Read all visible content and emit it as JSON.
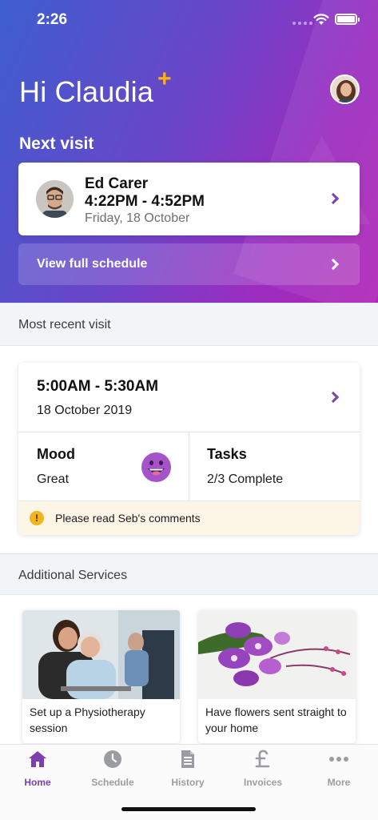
{
  "status_bar": {
    "time": "2:26"
  },
  "header": {
    "greeting": "Hi Claudia",
    "plus_mark": "+"
  },
  "next_visit": {
    "label": "Next visit",
    "carer_name": "Ed Carer",
    "time_range": "4:22PM - 4:52PM",
    "date": "Friday, 18 October"
  },
  "schedule_button": {
    "label": "View full schedule"
  },
  "recent": {
    "section_title": "Most recent visit",
    "time_range": "5:00AM - 5:30AM",
    "date": "18 October 2019",
    "mood_label": "Mood",
    "mood_value": "Great",
    "tasks_label": "Tasks",
    "tasks_value": "2/3 Complete",
    "notice": "Please read Seb's comments",
    "warning_glyph": "!"
  },
  "additional": {
    "section_title": "Additional Services",
    "cards": [
      {
        "text": "Set up a Physiotherapy session"
      },
      {
        "text": "Have flowers sent straight to your home"
      }
    ]
  },
  "tabs": [
    {
      "label": "Home",
      "icon": "home-icon",
      "active": true
    },
    {
      "label": "Schedule",
      "icon": "clock-icon",
      "active": false
    },
    {
      "label": "History",
      "icon": "document-icon",
      "active": false
    },
    {
      "label": "Invoices",
      "icon": "pound-icon",
      "active": false
    },
    {
      "label": "More",
      "icon": "more-dots-icon",
      "active": false
    }
  ],
  "colors": {
    "accent_purple": "#7b3fb1",
    "warning_yellow": "#f1b51c",
    "gradient_start": "#3e5fcf",
    "gradient_end": "#b026b6"
  }
}
